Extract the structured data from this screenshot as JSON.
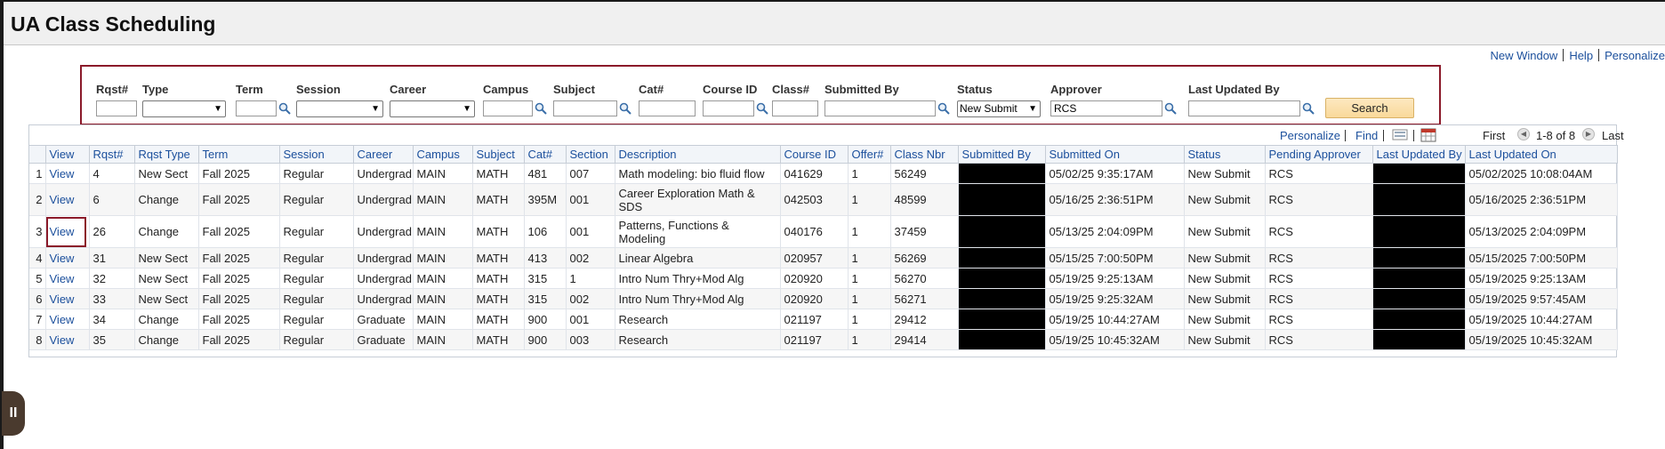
{
  "page": {
    "title": "UA Class Scheduling"
  },
  "top_links": {
    "new_window": "New Window",
    "help": "Help",
    "personalize": "Personalize"
  },
  "search": {
    "labels": {
      "rqst": "Rqst#",
      "type": "Type",
      "term": "Term",
      "session": "Session",
      "career": "Career",
      "campus": "Campus",
      "subject": "Subject",
      "cat": "Cat#",
      "course_id": "Course ID",
      "class": "Class#",
      "submitted_by": "Submitted By",
      "status": "Status",
      "approver": "Approver",
      "last_updated_by": "Last Updated By"
    },
    "values": {
      "rqst": "",
      "type": "",
      "term": "",
      "session": "",
      "career": "",
      "campus": "",
      "subject": "",
      "cat": "",
      "course_id": "",
      "class": "",
      "submitted_by": "",
      "status": "New Submit",
      "approver": "RCS",
      "last_updated_by": ""
    },
    "button": "Search"
  },
  "grid_nav": {
    "personalize": "Personalize",
    "find": "Find",
    "first": "First",
    "range": "1-8 of 8",
    "last": "Last",
    "view_all_icon": "view-all-icon",
    "download_icon": "download-icon"
  },
  "columns": [
    "",
    "View",
    "Rqst#",
    "Rqst Type",
    "Term",
    "Session",
    "Career",
    "Campus",
    "Subject",
    "Cat#",
    "Section",
    "Description",
    "Course ID",
    "Offer#",
    "Class Nbr",
    "Submitted By",
    "Submitted On",
    "Status",
    "Pending Approver",
    "Last Updated By",
    "Last Updated On"
  ],
  "rows": [
    {
      "n": "1",
      "view": "View",
      "rqst": "4",
      "type": "New Sect",
      "term": "Fall 2025",
      "session": "Regular",
      "career": "Undergrad",
      "campus": "MAIN",
      "subject": "MATH",
      "cat": "481",
      "section": "007",
      "desc": "Math modeling: bio fluid flow",
      "course_id": "041629",
      "offer": "1",
      "class_nbr": "56249",
      "submitted_by": "",
      "submitted_on": "05/02/25  9:35:17AM",
      "status": "New Submit",
      "approver": "RCS",
      "last_by": "",
      "last_on": "05/02/2025 10:08:04AM"
    },
    {
      "n": "2",
      "view": "View",
      "rqst": "6",
      "type": "Change",
      "term": "Fall 2025",
      "session": "Regular",
      "career": "Undergrad",
      "campus": "MAIN",
      "subject": "MATH",
      "cat": "395M",
      "section": "001",
      "desc": "Career Exploration Math & SDS",
      "course_id": "042503",
      "offer": "1",
      "class_nbr": "48599",
      "submitted_by": "",
      "submitted_on": "05/16/25  2:36:51PM",
      "status": "New Submit",
      "approver": "RCS",
      "last_by": "",
      "last_on": "05/16/2025  2:36:51PM"
    },
    {
      "n": "3",
      "view": "View",
      "rqst": "26",
      "type": "Change",
      "term": "Fall 2025",
      "session": "Regular",
      "career": "Undergrad",
      "campus": "MAIN",
      "subject": "MATH",
      "cat": "106",
      "section": "001",
      "desc": "Patterns, Functions & Modeling",
      "course_id": "040176",
      "offer": "1",
      "class_nbr": "37459",
      "submitted_by": "",
      "submitted_on": "05/13/25  2:04:09PM",
      "status": "New Submit",
      "approver": "RCS",
      "last_by": "",
      "last_on": "05/13/2025  2:04:09PM"
    },
    {
      "n": "4",
      "view": "View",
      "rqst": "31",
      "type": "New Sect",
      "term": "Fall 2025",
      "session": "Regular",
      "career": "Undergrad",
      "campus": "MAIN",
      "subject": "MATH",
      "cat": "413",
      "section": "002",
      "desc": "Linear Algebra",
      "course_id": "020957",
      "offer": "1",
      "class_nbr": "56269",
      "submitted_by": "",
      "submitted_on": "05/15/25  7:00:50PM",
      "status": "New Submit",
      "approver": "RCS",
      "last_by": "",
      "last_on": "05/15/2025  7:00:50PM"
    },
    {
      "n": "5",
      "view": "View",
      "rqst": "32",
      "type": "New Sect",
      "term": "Fall 2025",
      "session": "Regular",
      "career": "Undergrad",
      "campus": "MAIN",
      "subject": "MATH",
      "cat": "315",
      "section": "1",
      "desc": "Intro Num Thry+Mod Alg",
      "course_id": "020920",
      "offer": "1",
      "class_nbr": "56270",
      "submitted_by": "",
      "submitted_on": "05/19/25  9:25:13AM",
      "status": "New Submit",
      "approver": "RCS",
      "last_by": "",
      "last_on": "05/19/2025  9:25:13AM"
    },
    {
      "n": "6",
      "view": "View",
      "rqst": "33",
      "type": "New Sect",
      "term": "Fall 2025",
      "session": "Regular",
      "career": "Undergrad",
      "campus": "MAIN",
      "subject": "MATH",
      "cat": "315",
      "section": "002",
      "desc": "Intro Num Thry+Mod Alg",
      "course_id": "020920",
      "offer": "1",
      "class_nbr": "56271",
      "submitted_by": "",
      "submitted_on": "05/19/25  9:25:32AM",
      "status": "New Submit",
      "approver": "RCS",
      "last_by": "",
      "last_on": "05/19/2025  9:57:45AM"
    },
    {
      "n": "7",
      "view": "View",
      "rqst": "34",
      "type": "Change",
      "term": "Fall 2025",
      "session": "Regular",
      "career": "Graduate",
      "campus": "MAIN",
      "subject": "MATH",
      "cat": "900",
      "section": "001",
      "desc": "Research",
      "course_id": "021197",
      "offer": "1",
      "class_nbr": "29412",
      "submitted_by": "",
      "submitted_on": "05/19/25 10:44:27AM",
      "status": "New Submit",
      "approver": "RCS",
      "last_by": "",
      "last_on": "05/19/2025 10:44:27AM"
    },
    {
      "n": "8",
      "view": "View",
      "rqst": "35",
      "type": "Change",
      "term": "Fall 2025",
      "session": "Regular",
      "career": "Graduate",
      "campus": "MAIN",
      "subject": "MATH",
      "cat": "900",
      "section": "003",
      "desc": "Research",
      "course_id": "021197",
      "offer": "1",
      "class_nbr": "29414",
      "submitted_by": "",
      "submitted_on": "05/19/25 10:45:32AM",
      "status": "New Submit",
      "approver": "RCS",
      "last_by": "",
      "last_on": "05/19/2025 10:45:32AM"
    }
  ],
  "side_handle": "II",
  "colors": {
    "link": "#1b4f9c",
    "highlight_border": "#8b1a2a",
    "search_button": "#f9d99a"
  }
}
